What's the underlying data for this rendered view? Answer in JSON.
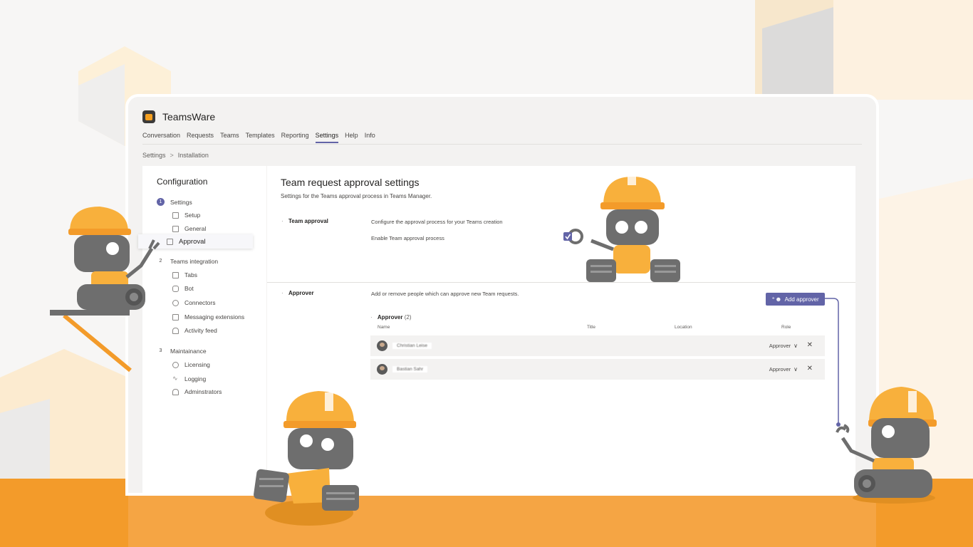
{
  "app": {
    "title": "TeamsWare"
  },
  "nav": [
    "Conversation",
    "Requests",
    "Teams",
    "Templates",
    "Reporting",
    "Settings",
    "Help",
    "Info"
  ],
  "nav_active": "Settings",
  "breadcrumb": {
    "root": "Settings",
    "separator": ">",
    "current": "Installation"
  },
  "sidebar": {
    "title": "Configuration",
    "groups": [
      {
        "num": "1",
        "label": "Settings",
        "items": [
          "Setup",
          "General",
          "Approval"
        ]
      },
      {
        "num": "2",
        "label": "Teams integration",
        "items": [
          "Tabs",
          "Bot",
          "Connectors",
          "Messaging extensions",
          "Activity feed"
        ]
      },
      {
        "num": "3",
        "label": "Maintainance",
        "items": [
          "Licensing",
          "Logging",
          "Adminstrators"
        ]
      }
    ],
    "selected": "Approval"
  },
  "main": {
    "title": "Team request approval settings",
    "subtitle": "Settings for the Teams approval process in Teams Manager.",
    "team_approval": {
      "label": "Team approval",
      "desc": "Configure the approval process for your Teams creation",
      "enable_label": "Enable Team approval process",
      "enabled": true
    },
    "approver": {
      "label": "Approver",
      "desc": "Add or remove people which can approve new Team requests.",
      "add_button": "Add approver",
      "list_title": "Approver",
      "count": "(2)",
      "columns": [
        "Name",
        "Title",
        "Location",
        "Role"
      ],
      "rows": [
        {
          "name": "Christian Leise",
          "role": "Approver"
        },
        {
          "name": "Bastian Sahr",
          "role": "Approver"
        }
      ]
    }
  },
  "colors": {
    "accent": "#6264a7",
    "orange": "#f39b2a",
    "robot_gray": "#6e6e6e",
    "robot_yellow": "#f8b03c"
  }
}
